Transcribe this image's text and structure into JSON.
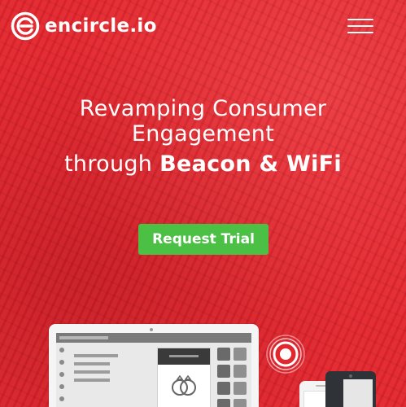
{
  "header": {
    "brand": "encircle.io",
    "logo_icon": "encircle-logo-icon",
    "menu_icon": "hamburger-menu-icon"
  },
  "hero": {
    "line1": "Revamping Consumer",
    "line2": "Engagement",
    "line3_prefix": "through",
    "line3_highlight": "Beacon & WiFi",
    "cta_label": "Request Trial"
  },
  "illustration": {
    "devices": [
      "laptop-illustration",
      "beacon-icon",
      "white-phone-illustration",
      "dark-phone-illustration"
    ],
    "card_icon": "wedding-rings-icon"
  },
  "colors": {
    "background": "#e3272f",
    "cta": "#4cc045",
    "text": "#ffffff"
  }
}
